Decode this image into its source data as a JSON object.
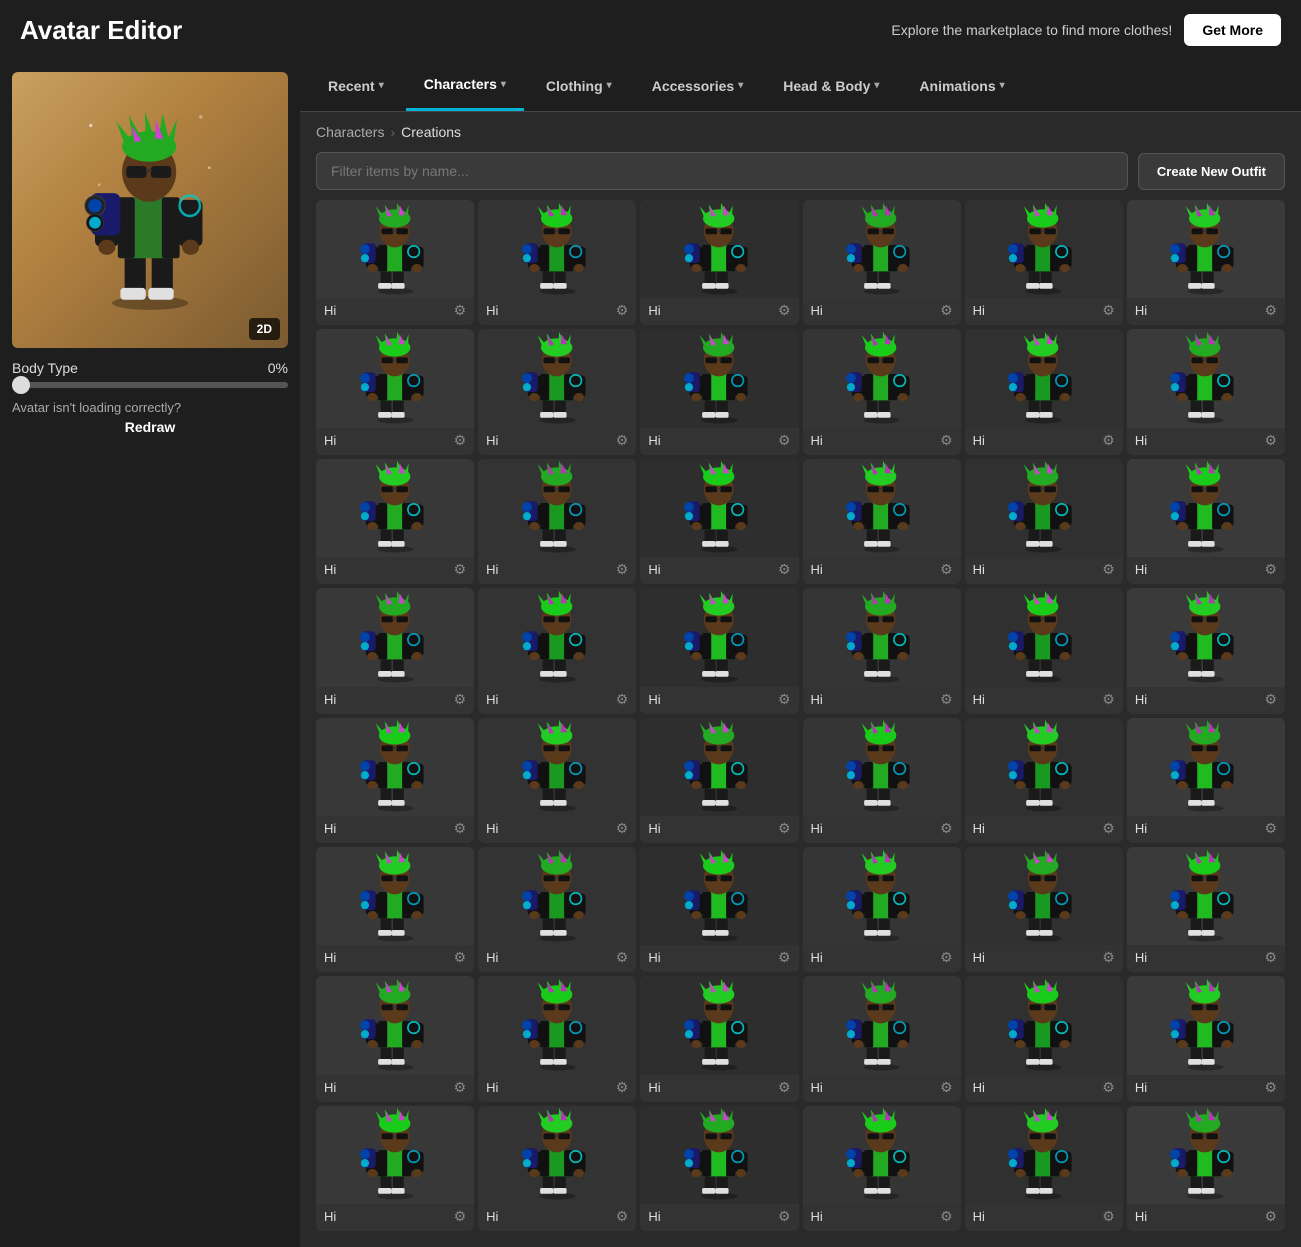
{
  "header": {
    "title": "Avatar Editor",
    "promo": "Explore the marketplace to find more clothes!",
    "get_more_label": "Get More"
  },
  "nav": {
    "tabs": [
      {
        "label": "Recent",
        "has_chevron": true,
        "active": false
      },
      {
        "label": "Characters",
        "has_chevron": true,
        "active": true
      },
      {
        "label": "Clothing",
        "has_chevron": true,
        "active": false
      },
      {
        "label": "Accessories",
        "has_chevron": true,
        "active": false
      },
      {
        "label": "Head & Body",
        "has_chevron": true,
        "active": false
      },
      {
        "label": "Animations",
        "has_chevron": true,
        "active": false
      }
    ]
  },
  "breadcrumb": {
    "parent": "Characters",
    "child": "Creations"
  },
  "filter": {
    "placeholder": "Filter items by name...",
    "create_outfit_label": "Create New Outfit"
  },
  "avatar": {
    "body_type_label": "Body Type",
    "body_type_value": "0%",
    "badge_2d": "2D",
    "warning_text": "Avatar isn't loading correctly?",
    "redraw_label": "Redraw"
  },
  "grid": {
    "items": [
      {
        "name": "Hi"
      },
      {
        "name": "Hi"
      },
      {
        "name": "Hi"
      },
      {
        "name": "Hi"
      },
      {
        "name": "Hi"
      },
      {
        "name": "Hi"
      },
      {
        "name": "Hi"
      },
      {
        "name": "Hi"
      },
      {
        "name": "Hi"
      },
      {
        "name": "Hi"
      },
      {
        "name": "Hi"
      },
      {
        "name": "Hi"
      },
      {
        "name": "Hi"
      },
      {
        "name": "Hi"
      },
      {
        "name": "Hi"
      },
      {
        "name": "Hi"
      },
      {
        "name": "Hi"
      },
      {
        "name": "Hi"
      },
      {
        "name": "Hi"
      },
      {
        "name": "Hi"
      },
      {
        "name": "Hi"
      },
      {
        "name": "Hi"
      },
      {
        "name": "Hi"
      },
      {
        "name": "Hi"
      },
      {
        "name": "Hi"
      },
      {
        "name": "Hi"
      },
      {
        "name": "Hi"
      },
      {
        "name": "Hi"
      },
      {
        "name": "Hi"
      },
      {
        "name": "Hi"
      },
      {
        "name": "Hi"
      },
      {
        "name": "Hi"
      },
      {
        "name": "Hi"
      },
      {
        "name": "Hi"
      },
      {
        "name": "Hi"
      },
      {
        "name": "Hi"
      },
      {
        "name": "Hi"
      },
      {
        "name": "Hi"
      },
      {
        "name": "Hi"
      },
      {
        "name": "Hi"
      },
      {
        "name": "Hi"
      },
      {
        "name": "Hi"
      },
      {
        "name": "Hi"
      },
      {
        "name": "Hi"
      },
      {
        "name": "Hi"
      },
      {
        "name": "Hi"
      },
      {
        "name": "Hi"
      },
      {
        "name": "Hi"
      }
    ]
  },
  "colors": {
    "accent": "#00b4d8",
    "bg_dark": "#1e1e1e",
    "bg_main": "#2a2a2a",
    "card_bg": "#333333"
  }
}
